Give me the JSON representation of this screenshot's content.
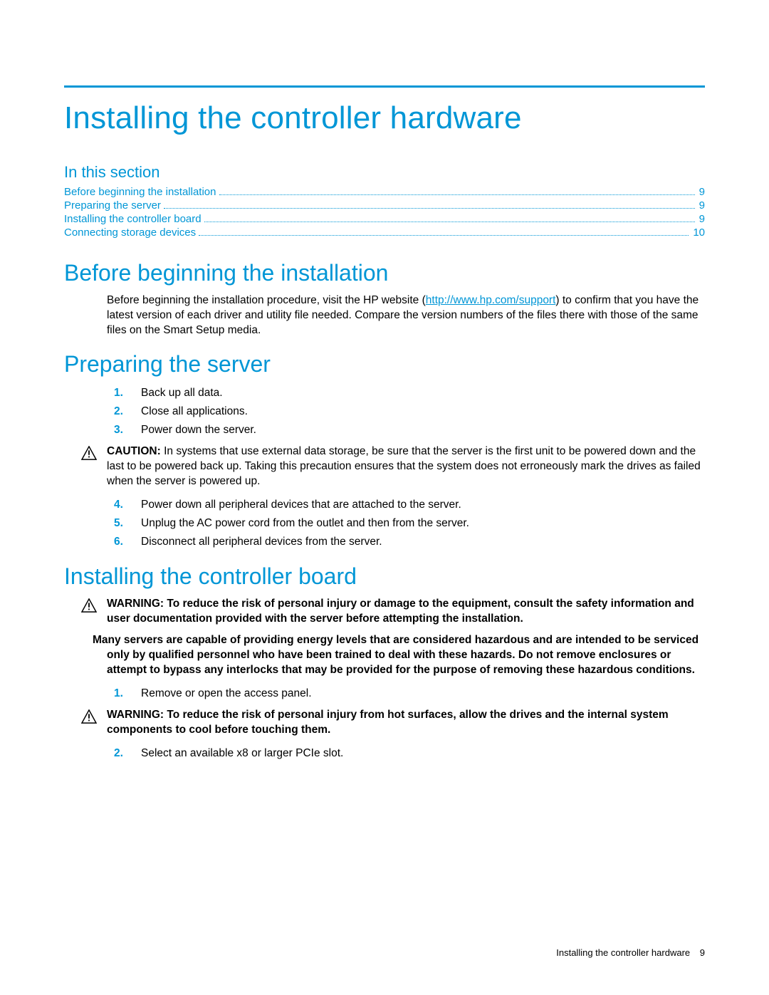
{
  "title": "Installing the controller hardware",
  "in_this_section_heading": "In this section",
  "toc": [
    {
      "label": "Before beginning the installation",
      "page": "9"
    },
    {
      "label": "Preparing the server",
      "page": "9"
    },
    {
      "label": "Installing the controller board",
      "page": "9"
    },
    {
      "label": "Connecting storage devices",
      "page": "10"
    }
  ],
  "sections": {
    "before": {
      "heading": "Before beginning the installation",
      "body_prefix": "Before beginning the installation procedure, visit the HP website (",
      "link_text": "http://www.hp.com/support",
      "body_suffix": ") to confirm that you have the latest version of each driver and utility file needed. Compare the version numbers of the files there with those of the same files on the Smart Setup media."
    },
    "preparing": {
      "heading": "Preparing the server",
      "steps_a": [
        "Back up all data.",
        "Close all applications.",
        "Power down the server."
      ],
      "caution_label": "CAUTION:",
      "caution_text": "  In systems that use external data storage, be sure that the server is the first unit to be powered down and the last to be powered back up. Taking this precaution ensures that the system does not erroneously mark the drives as failed when the server is powered up.",
      "steps_b": [
        "Power down all peripheral devices that are attached to the server.",
        "Unplug the AC power cord from the outlet and then from the server.",
        "Disconnect all peripheral devices from the server."
      ]
    },
    "installing": {
      "heading": "Installing the controller board",
      "warning1_label": "WARNING:",
      "warning1_text": "  To reduce the risk of personal injury or damage to the equipment, consult the safety information and user documentation provided with the server before attempting the installation.",
      "hazard_text": "Many servers are capable of providing energy levels that are considered hazardous and are intended to be serviced only by qualified personnel who have been trained to deal with these hazards. Do not remove enclosures or attempt to bypass any interlocks that may be provided for the purpose of removing these hazardous conditions.",
      "step1": "Remove or open the access panel.",
      "warning2_label": "WARNING:",
      "warning2_text": "  To reduce the risk of personal injury from hot surfaces, allow the drives and the internal system components to cool before touching them.",
      "step2": "Select an available x8 or larger PCIe slot."
    }
  },
  "footer": {
    "title": "Installing the controller hardware",
    "page": "9"
  }
}
